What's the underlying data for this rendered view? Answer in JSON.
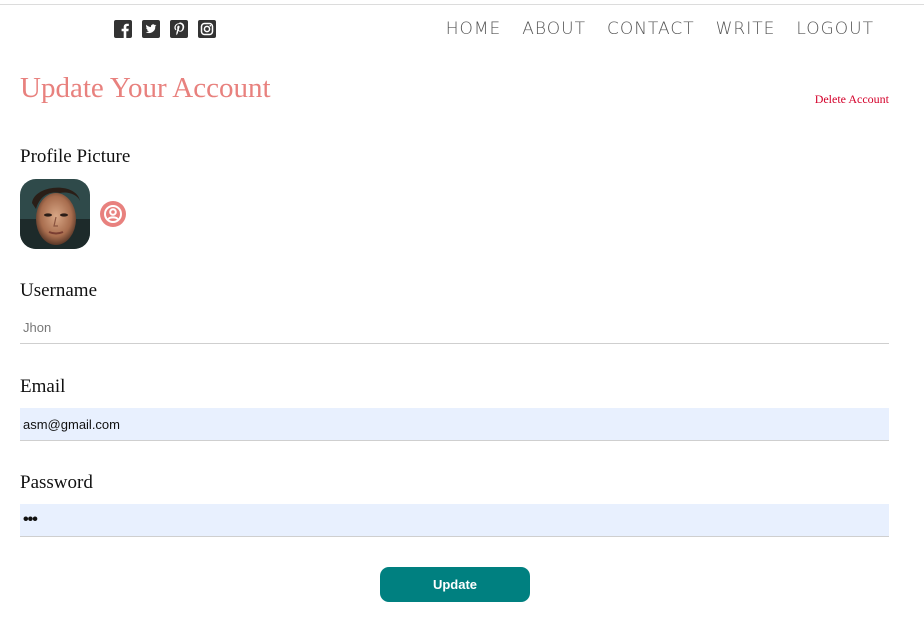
{
  "social": {
    "icons": [
      "facebook-square-icon",
      "twitter-square-icon",
      "pinterest-square-icon",
      "instagram-square-icon"
    ]
  },
  "nav": {
    "items": [
      {
        "label": "HOME"
      },
      {
        "label": "ABOUT"
      },
      {
        "label": "CONTACT"
      },
      {
        "label": "WRITE"
      },
      {
        "label": "LOGOUT"
      }
    ]
  },
  "page": {
    "title": "Update Your Account",
    "delete_label": "Delete Account"
  },
  "form": {
    "profile_picture_label": "Profile Picture",
    "username_label": "Username",
    "username_placeholder": "Jhon",
    "email_label": "Email",
    "email_value": "asm@gmail.com",
    "password_label": "Password",
    "password_value": "•••",
    "submit_label": "Update"
  },
  "colors": {
    "title": "#e8817e",
    "delete": "#d4002a",
    "button": "#008080",
    "autofill_bg": "#e8f0fe",
    "upload_icon": "#e8817e"
  }
}
